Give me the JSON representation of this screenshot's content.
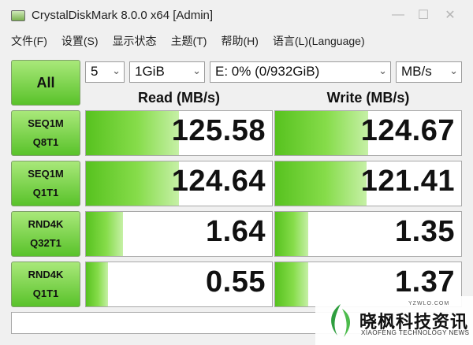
{
  "window": {
    "title": "CrystalDiskMark 8.0.0 x64 [Admin]"
  },
  "menu": [
    "文件(F)",
    "设置(S)",
    "显示状态",
    "主题(T)",
    "帮助(H)",
    "语言(L)(Language)"
  ],
  "controls": {
    "all_label": "All",
    "count": "5",
    "size": "1GiB",
    "drive": "E: 0% (0/932GiB)",
    "unit": "MB/s"
  },
  "headers": {
    "read": "Read (MB/s)",
    "write": "Write (MB/s)"
  },
  "tests": [
    {
      "line1": "SEQ1M",
      "line2": "Q8T1",
      "read": "125.58",
      "write": "124.67",
      "read_fill": 0.5,
      "write_fill": 0.5
    },
    {
      "line1": "SEQ1M",
      "line2": "Q1T1",
      "read": "124.64",
      "write": "121.41",
      "read_fill": 0.5,
      "write_fill": 0.49
    },
    {
      "line1": "RND4K",
      "line2": "Q32T1",
      "read": "1.64",
      "write": "1.35",
      "read_fill": 0.2,
      "write_fill": 0.18
    },
    {
      "line1": "RND4K",
      "line2": "Q1T1",
      "read": "0.55",
      "write": "1.37",
      "read_fill": 0.12,
      "write_fill": 0.18
    }
  ],
  "comment": "",
  "watermark": {
    "url": "YZWLO.COM",
    "name_cn": "晓枫科技资讯",
    "name_en": "XIAOFENG TECHNOLOGY NEWS"
  },
  "colors": {
    "accent_green": "#57c21f",
    "button_green": "#59c22a"
  }
}
